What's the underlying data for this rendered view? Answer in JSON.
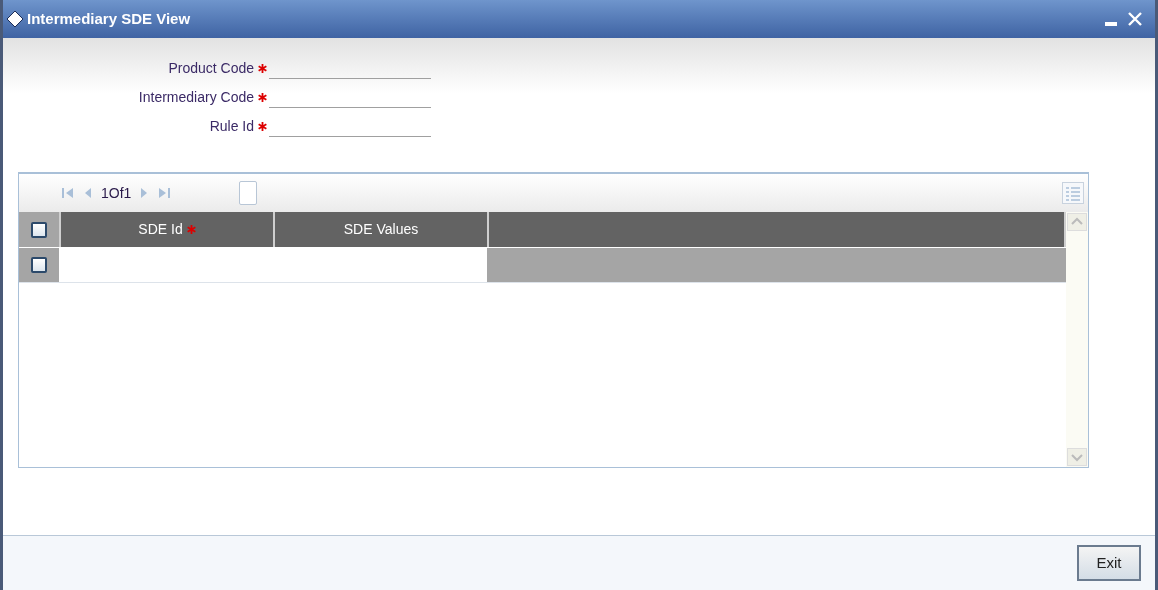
{
  "window": {
    "title": "Intermediary SDE View"
  },
  "fields": [
    {
      "label": "Product Code",
      "required": true
    },
    {
      "label": "Intermediary Code",
      "required": true
    },
    {
      "label": "Rule Id",
      "required": true
    }
  ],
  "grid": {
    "pager": "1Of1",
    "select_all_checked": false,
    "columns": [
      {
        "label": "SDE Id",
        "required": true
      },
      {
        "label": "SDE Values",
        "required": false
      }
    ],
    "rows": [
      {
        "checked": false
      }
    ]
  },
  "buttons": [
    "Exit"
  ]
}
